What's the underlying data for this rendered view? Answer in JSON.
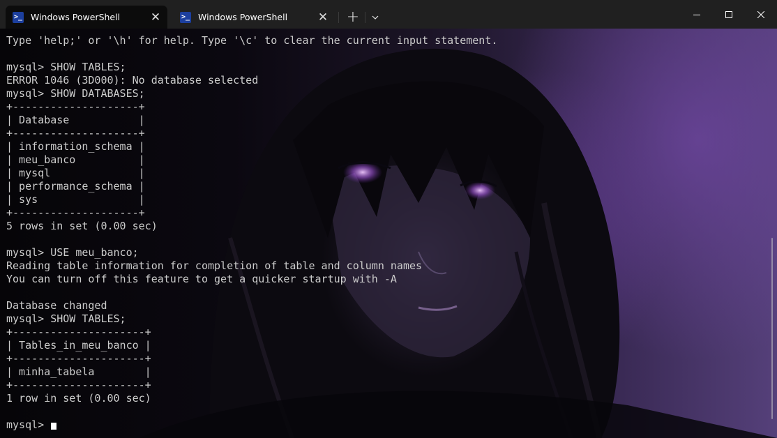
{
  "tabs": [
    {
      "label": "Windows PowerShell",
      "active": true,
      "icon": "powershell-icon"
    },
    {
      "label": "Windows PowerShell",
      "active": false,
      "icon": "powershell-icon"
    }
  ],
  "tab_bar": {
    "new_tab": "+",
    "dropdown": "⌄"
  },
  "window_controls": {
    "minimize_icon": "minimize-icon",
    "maximize_icon": "maximize-icon",
    "close_icon": "close-icon"
  },
  "terminal": {
    "lines": [
      "Type 'help;' or '\\h' for help. Type '\\c' to clear the current input statement.",
      "",
      "mysql> SHOW TABLES;",
      "ERROR 1046 (3D000): No database selected",
      "mysql> SHOW DATABASES;",
      "+--------------------+",
      "| Database           |",
      "+--------------------+",
      "| information_schema |",
      "| meu_banco          |",
      "| mysql              |",
      "| performance_schema |",
      "| sys                |",
      "+--------------------+",
      "5 rows in set (0.00 sec)",
      "",
      "mysql> USE meu_banco;",
      "Reading table information for completion of table and column names",
      "You can turn off this feature to get a quicker startup with -A",
      "",
      "Database changed",
      "mysql> SHOW TABLES;",
      "+---------------------+",
      "| Tables_in_meu_banco |",
      "+---------------------+",
      "| minha_tabela        |",
      "+---------------------+",
      "1 row in set (0.00 sec)",
      ""
    ],
    "prompt": "mysql> ",
    "colors": {
      "foreground": "#cccccc",
      "cursor": "#ffffff",
      "background_accent": "#55407a"
    }
  }
}
